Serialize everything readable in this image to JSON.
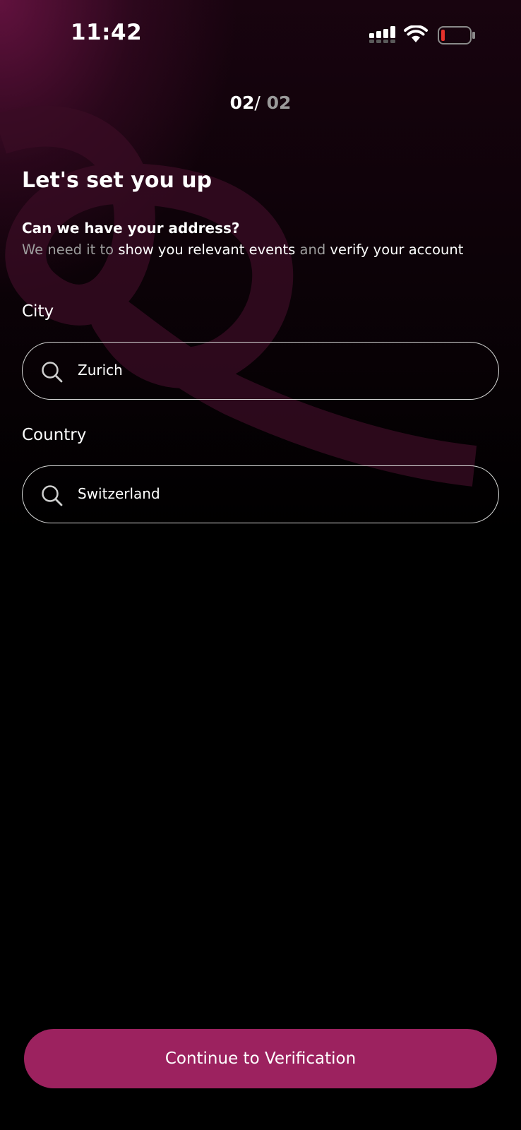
{
  "status_bar": {
    "time": "11:42",
    "icons": [
      "signal-icon",
      "wifi-icon",
      "battery-low-icon"
    ]
  },
  "step": {
    "current": "02",
    "separator": "/",
    "total": " 02"
  },
  "title": "Let's set you up",
  "question": "Can we have your address?",
  "explanation": {
    "part1": "We need it to ",
    "part2": "show you relevant events",
    "part3": " and ",
    "part4": "verify your account"
  },
  "fields": {
    "city": {
      "label": "City",
      "value": "Zurich",
      "icon": "search-icon"
    },
    "country": {
      "label": "Country",
      "value": "Switzerland",
      "icon": "search-icon"
    }
  },
  "continue_button": {
    "label": "Continue to Verification"
  },
  "colors": {
    "accent": "#9c225f",
    "background": "#000000",
    "muted_text": "#9e9e9e",
    "battery_low": "#e5312b"
  }
}
